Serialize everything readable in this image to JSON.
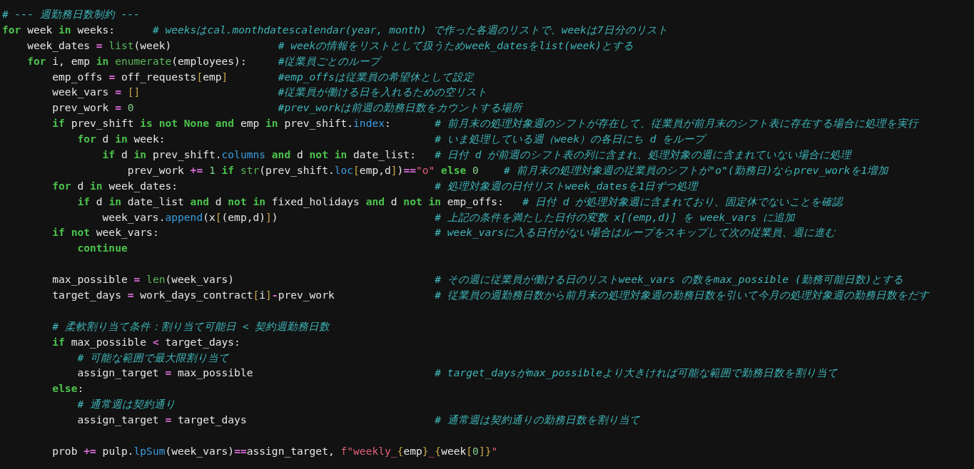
{
  "editor": {
    "lines": [
      {
        "kind": "comment",
        "comment": "# --- 週勤務日数制約 ---"
      },
      {
        "kind": "code",
        "code": [
          {
            "kind": "kw",
            "text": "for"
          },
          {
            "kind": "txt",
            "text": " week "
          },
          {
            "kind": "kw",
            "text": "in"
          },
          {
            "kind": "txt",
            "text": " weeks:      "
          }
        ],
        "comment": "# weeksはcal.monthdatescalendar(year, month) で作った各週のリストで、weekは7日分のリスト"
      },
      {
        "kind": "code",
        "code": [
          {
            "kind": "txt",
            "text": "    week_dates "
          },
          {
            "kind": "op",
            "text": "= "
          },
          {
            "kind": "fn",
            "text": "list"
          },
          {
            "kind": "txt",
            "text": "(week)                 "
          }
        ],
        "comment": "# weekの情報をリストとして扱うためweek_datesをlist(week)とする"
      },
      {
        "kind": "code",
        "code": [
          {
            "kind": "kw",
            "text": "    for"
          },
          {
            "kind": "txt",
            "text": " i, emp "
          },
          {
            "kind": "kw",
            "text": "in "
          },
          {
            "kind": "fn",
            "text": "enumerate"
          },
          {
            "kind": "txt",
            "text": "(employees):     "
          }
        ],
        "comment": "#従業員ごとのループ"
      },
      {
        "kind": "code",
        "code": [
          {
            "kind": "txt",
            "text": "        emp_offs "
          },
          {
            "kind": "op",
            "text": "="
          },
          {
            "kind": "txt",
            "text": " off_requests"
          },
          {
            "kind": "br",
            "text": "["
          },
          {
            "kind": "txt",
            "text": "emp"
          },
          {
            "kind": "br",
            "text": "]        "
          }
        ],
        "comment": "#emp_offsは従業員の希望休として設定"
      },
      {
        "kind": "code",
        "code": [
          {
            "kind": "txt",
            "text": "        week_vars "
          },
          {
            "kind": "op",
            "text": "= "
          },
          {
            "kind": "br",
            "text": "[]                      "
          }
        ],
        "comment": "#従業員が働ける日を入れるための空リスト"
      },
      {
        "kind": "code",
        "code": [
          {
            "kind": "txt",
            "text": "        prev_work "
          },
          {
            "kind": "op",
            "text": "= "
          },
          {
            "kind": "num",
            "text": "0                       "
          }
        ],
        "comment": "#prev_workは前週の勤務日数をカウントする場所"
      },
      {
        "kind": "code",
        "code": [
          {
            "kind": "kw",
            "text": "        if"
          },
          {
            "kind": "txt",
            "text": " prev_shift "
          },
          {
            "kind": "kw",
            "text": "is not None and"
          },
          {
            "kind": "txt",
            "text": " emp "
          },
          {
            "kind": "kw",
            "text": "in"
          },
          {
            "kind": "txt",
            "text": " prev_shift."
          },
          {
            "kind": "attr",
            "text": "index"
          },
          {
            "kind": "txt",
            "text": ":       "
          }
        ],
        "comment": "# 前月末の処理対象週のシフトが存在して、従業員が前月末のシフト表に存在する場合に処理を実行"
      },
      {
        "kind": "code",
        "code": [
          {
            "kind": "kw",
            "text": "            for"
          },
          {
            "kind": "txt",
            "text": " d "
          },
          {
            "kind": "kw",
            "text": "in"
          },
          {
            "kind": "txt",
            "text": " week:                                           "
          }
        ],
        "comment": "# いま処理している週（week）の各日にち d をループ"
      },
      {
        "kind": "code",
        "code": [
          {
            "kind": "kw",
            "text": "                if"
          },
          {
            "kind": "txt",
            "text": " d "
          },
          {
            "kind": "kw",
            "text": "in"
          },
          {
            "kind": "txt",
            "text": " prev_shift."
          },
          {
            "kind": "attr",
            "text": "columns"
          },
          {
            "kind": "kw",
            "text": " and"
          },
          {
            "kind": "txt",
            "text": " d "
          },
          {
            "kind": "kw",
            "text": "not in"
          },
          {
            "kind": "txt",
            "text": " date_list:   "
          }
        ],
        "comment": "# 日付 d が前週のシフト表の列に含まれ、処理対象の週に含まれていない場合に処理"
      },
      {
        "kind": "code",
        "code": [
          {
            "kind": "txt",
            "text": "                    prev_work "
          },
          {
            "kind": "op",
            "text": "+="
          },
          {
            "kind": "num",
            "text": " 1"
          },
          {
            "kind": "kw",
            "text": " if"
          },
          {
            "kind": "fn",
            "text": " str"
          },
          {
            "kind": "txt",
            "text": "(prev_shift."
          },
          {
            "kind": "attr",
            "text": "loc"
          },
          {
            "kind": "br",
            "text": "["
          },
          {
            "kind": "txt",
            "text": "emp,d"
          },
          {
            "kind": "br",
            "text": "]"
          },
          {
            "kind": "txt",
            "text": ")"
          },
          {
            "kind": "op",
            "text": "=="
          },
          {
            "kind": "str",
            "text": "\"o\""
          },
          {
            "kind": "kw",
            "text": " else"
          },
          {
            "kind": "num",
            "text": " 0    "
          }
        ],
        "comment": "# 前月末の処理対象週の従業員のシフトが\"o\"(勤務日)ならprev_workを1増加"
      },
      {
        "kind": "code",
        "code": [
          {
            "kind": "kw",
            "text": "        for"
          },
          {
            "kind": "txt",
            "text": " d "
          },
          {
            "kind": "kw",
            "text": "in"
          },
          {
            "kind": "txt",
            "text": " week_dates:                                         "
          }
        ],
        "comment": "# 処理対象週の日付リストweek_datesを1日ずつ処理"
      },
      {
        "kind": "code",
        "code": [
          {
            "kind": "kw",
            "text": "            if"
          },
          {
            "kind": "txt",
            "text": " d "
          },
          {
            "kind": "kw",
            "text": "in"
          },
          {
            "kind": "txt",
            "text": " date_list "
          },
          {
            "kind": "kw",
            "text": "and"
          },
          {
            "kind": "txt",
            "text": " d "
          },
          {
            "kind": "kw",
            "text": "not in"
          },
          {
            "kind": "txt",
            "text": " fixed_holidays "
          },
          {
            "kind": "kw",
            "text": "and"
          },
          {
            "kind": "txt",
            "text": " d "
          },
          {
            "kind": "kw",
            "text": "not in"
          },
          {
            "kind": "txt",
            "text": " emp_offs:   "
          }
        ],
        "comment": "# 日付 d が処理対象週に含まれており、固定休でないことを確認"
      },
      {
        "kind": "code",
        "code": [
          {
            "kind": "txt",
            "text": "                week_vars."
          },
          {
            "kind": "attr",
            "text": "append"
          },
          {
            "kind": "txt",
            "text": "(x"
          },
          {
            "kind": "br",
            "text": "["
          },
          {
            "kind": "txt",
            "text": "(emp,d)"
          },
          {
            "kind": "br",
            "text": "]"
          },
          {
            "kind": "txt",
            "text": ")                         "
          }
        ],
        "comment": "# 上記の条件を満たした日付の変数 x[(emp,d)] を week_vars に追加"
      },
      {
        "kind": "code",
        "code": [
          {
            "kind": "kw",
            "text": "        if not"
          },
          {
            "kind": "txt",
            "text": " week_vars:                                            "
          }
        ],
        "comment": "# week_varsに入る日付がない場合はループをスキップして次の従業員、週に進む"
      },
      {
        "kind": "code",
        "code": [
          {
            "kind": "kw",
            "text": "            continue"
          }
        ]
      },
      {
        "kind": "blank"
      },
      {
        "kind": "code",
        "code": [
          {
            "kind": "txt",
            "text": "        max_possible "
          },
          {
            "kind": "op",
            "text": "= "
          },
          {
            "kind": "fn",
            "text": "len"
          },
          {
            "kind": "txt",
            "text": "(week_vars)                                "
          }
        ],
        "comment": "# その週に従業員が働ける日のリストweek_vars の数をmax_possible (勤務可能日数)とする"
      },
      {
        "kind": "code",
        "code": [
          {
            "kind": "txt",
            "text": "        target_days "
          },
          {
            "kind": "op",
            "text": "="
          },
          {
            "kind": "txt",
            "text": " work_days_contract"
          },
          {
            "kind": "br",
            "text": "["
          },
          {
            "kind": "txt",
            "text": "i"
          },
          {
            "kind": "br",
            "text": "]"
          },
          {
            "kind": "op",
            "text": "-"
          },
          {
            "kind": "txt",
            "text": "prev_work                "
          }
        ],
        "comment": "# 従業員の週勤務日数から前月末の処理対象週の勤務日数を引いて今月の処理対象週の勤務日数をだす"
      },
      {
        "kind": "blank"
      },
      {
        "kind": "comment",
        "comment": "        # 柔軟割り当て条件：割り当て可能日 < 契約週勤務日数"
      },
      {
        "kind": "code",
        "code": [
          {
            "kind": "kw",
            "text": "        if"
          },
          {
            "kind": "txt",
            "text": " max_possible "
          },
          {
            "kind": "op",
            "text": "<"
          },
          {
            "kind": "txt",
            "text": " target_days:"
          }
        ]
      },
      {
        "kind": "comment",
        "comment": "            # 可能な範囲で最大限割り当て"
      },
      {
        "kind": "code",
        "code": [
          {
            "kind": "txt",
            "text": "            assign_target "
          },
          {
            "kind": "op",
            "text": "="
          },
          {
            "kind": "txt",
            "text": " max_possible                             "
          }
        ],
        "comment": "# target_daysがmax_possibleより大きければ可能な範囲で勤務日数を割り当て"
      },
      {
        "kind": "code",
        "code": [
          {
            "kind": "kw",
            "text": "        else"
          },
          {
            "kind": "txt",
            "text": ":"
          }
        ]
      },
      {
        "kind": "comment",
        "comment": "            # 通常週は契約通り"
      },
      {
        "kind": "code",
        "code": [
          {
            "kind": "txt",
            "text": "            assign_target "
          },
          {
            "kind": "op",
            "text": "="
          },
          {
            "kind": "txt",
            "text": " target_days                              "
          }
        ],
        "comment": "# 通常週は契約通りの勤務日数を割り当て"
      },
      {
        "kind": "blank"
      },
      {
        "kind": "code",
        "code": [
          {
            "kind": "txt",
            "text": "        prob "
          },
          {
            "kind": "op",
            "text": "+="
          },
          {
            "kind": "txt",
            "text": " pulp."
          },
          {
            "kind": "attr",
            "text": "lpSum"
          },
          {
            "kind": "txt",
            "text": "(week_vars)"
          },
          {
            "kind": "op",
            "text": "=="
          },
          {
            "kind": "txt",
            "text": "assign_target, "
          },
          {
            "kind": "str",
            "text": "f\"weekly_"
          },
          {
            "kind": "br",
            "text": "{"
          },
          {
            "kind": "txt",
            "text": "emp"
          },
          {
            "kind": "br",
            "text": "}"
          },
          {
            "kind": "str",
            "text": "_"
          },
          {
            "kind": "br",
            "text": "{"
          },
          {
            "kind": "txt",
            "text": "week"
          },
          {
            "kind": "br",
            "text": "["
          },
          {
            "kind": "num",
            "text": "0"
          },
          {
            "kind": "br",
            "text": "]}"
          },
          {
            "kind": "str",
            "text": "\""
          }
        ]
      }
    ]
  }
}
